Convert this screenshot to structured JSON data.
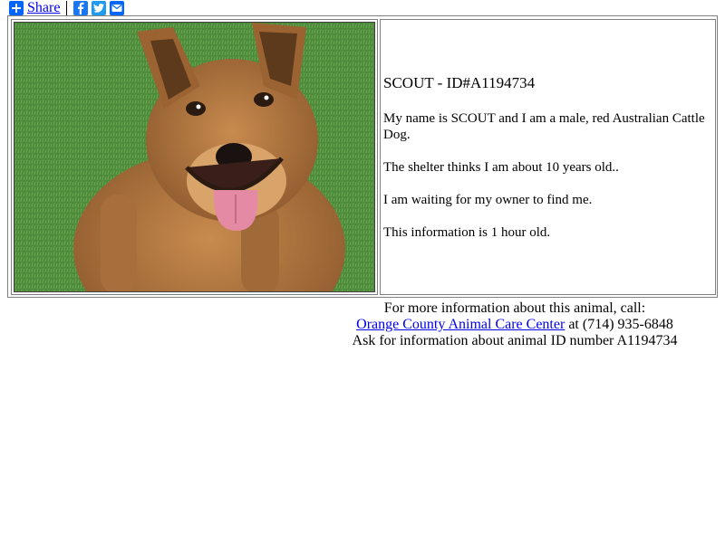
{
  "share": {
    "label": "Share",
    "icons": [
      "plus-icon",
      "facebook-icon",
      "twitter-icon",
      "email-icon"
    ],
    "colors": {
      "plus": "#0166ff",
      "facebook": "#1877f2",
      "twitter": "#1d9bf0",
      "email": "#0166ff"
    }
  },
  "animal": {
    "title": "SCOUT - ID#A1194734",
    "description": "My name is SCOUT and I am a male, red Australian Cattle Dog.",
    "age_text": "The shelter thinks I am about 10 years old..",
    "status_text": "I am waiting for my owner to find me.",
    "freshness_text": "This information is 1 hour old."
  },
  "contact": {
    "line1": "For more information about this animal, call:",
    "center_name": "Orange County Animal Care Center",
    "phone_text": " at (714) 935-6848",
    "line3": "Ask for information about animal ID number A1194734"
  },
  "colors": {
    "link": "#0000ee",
    "grass": "#4e8c3a"
  }
}
